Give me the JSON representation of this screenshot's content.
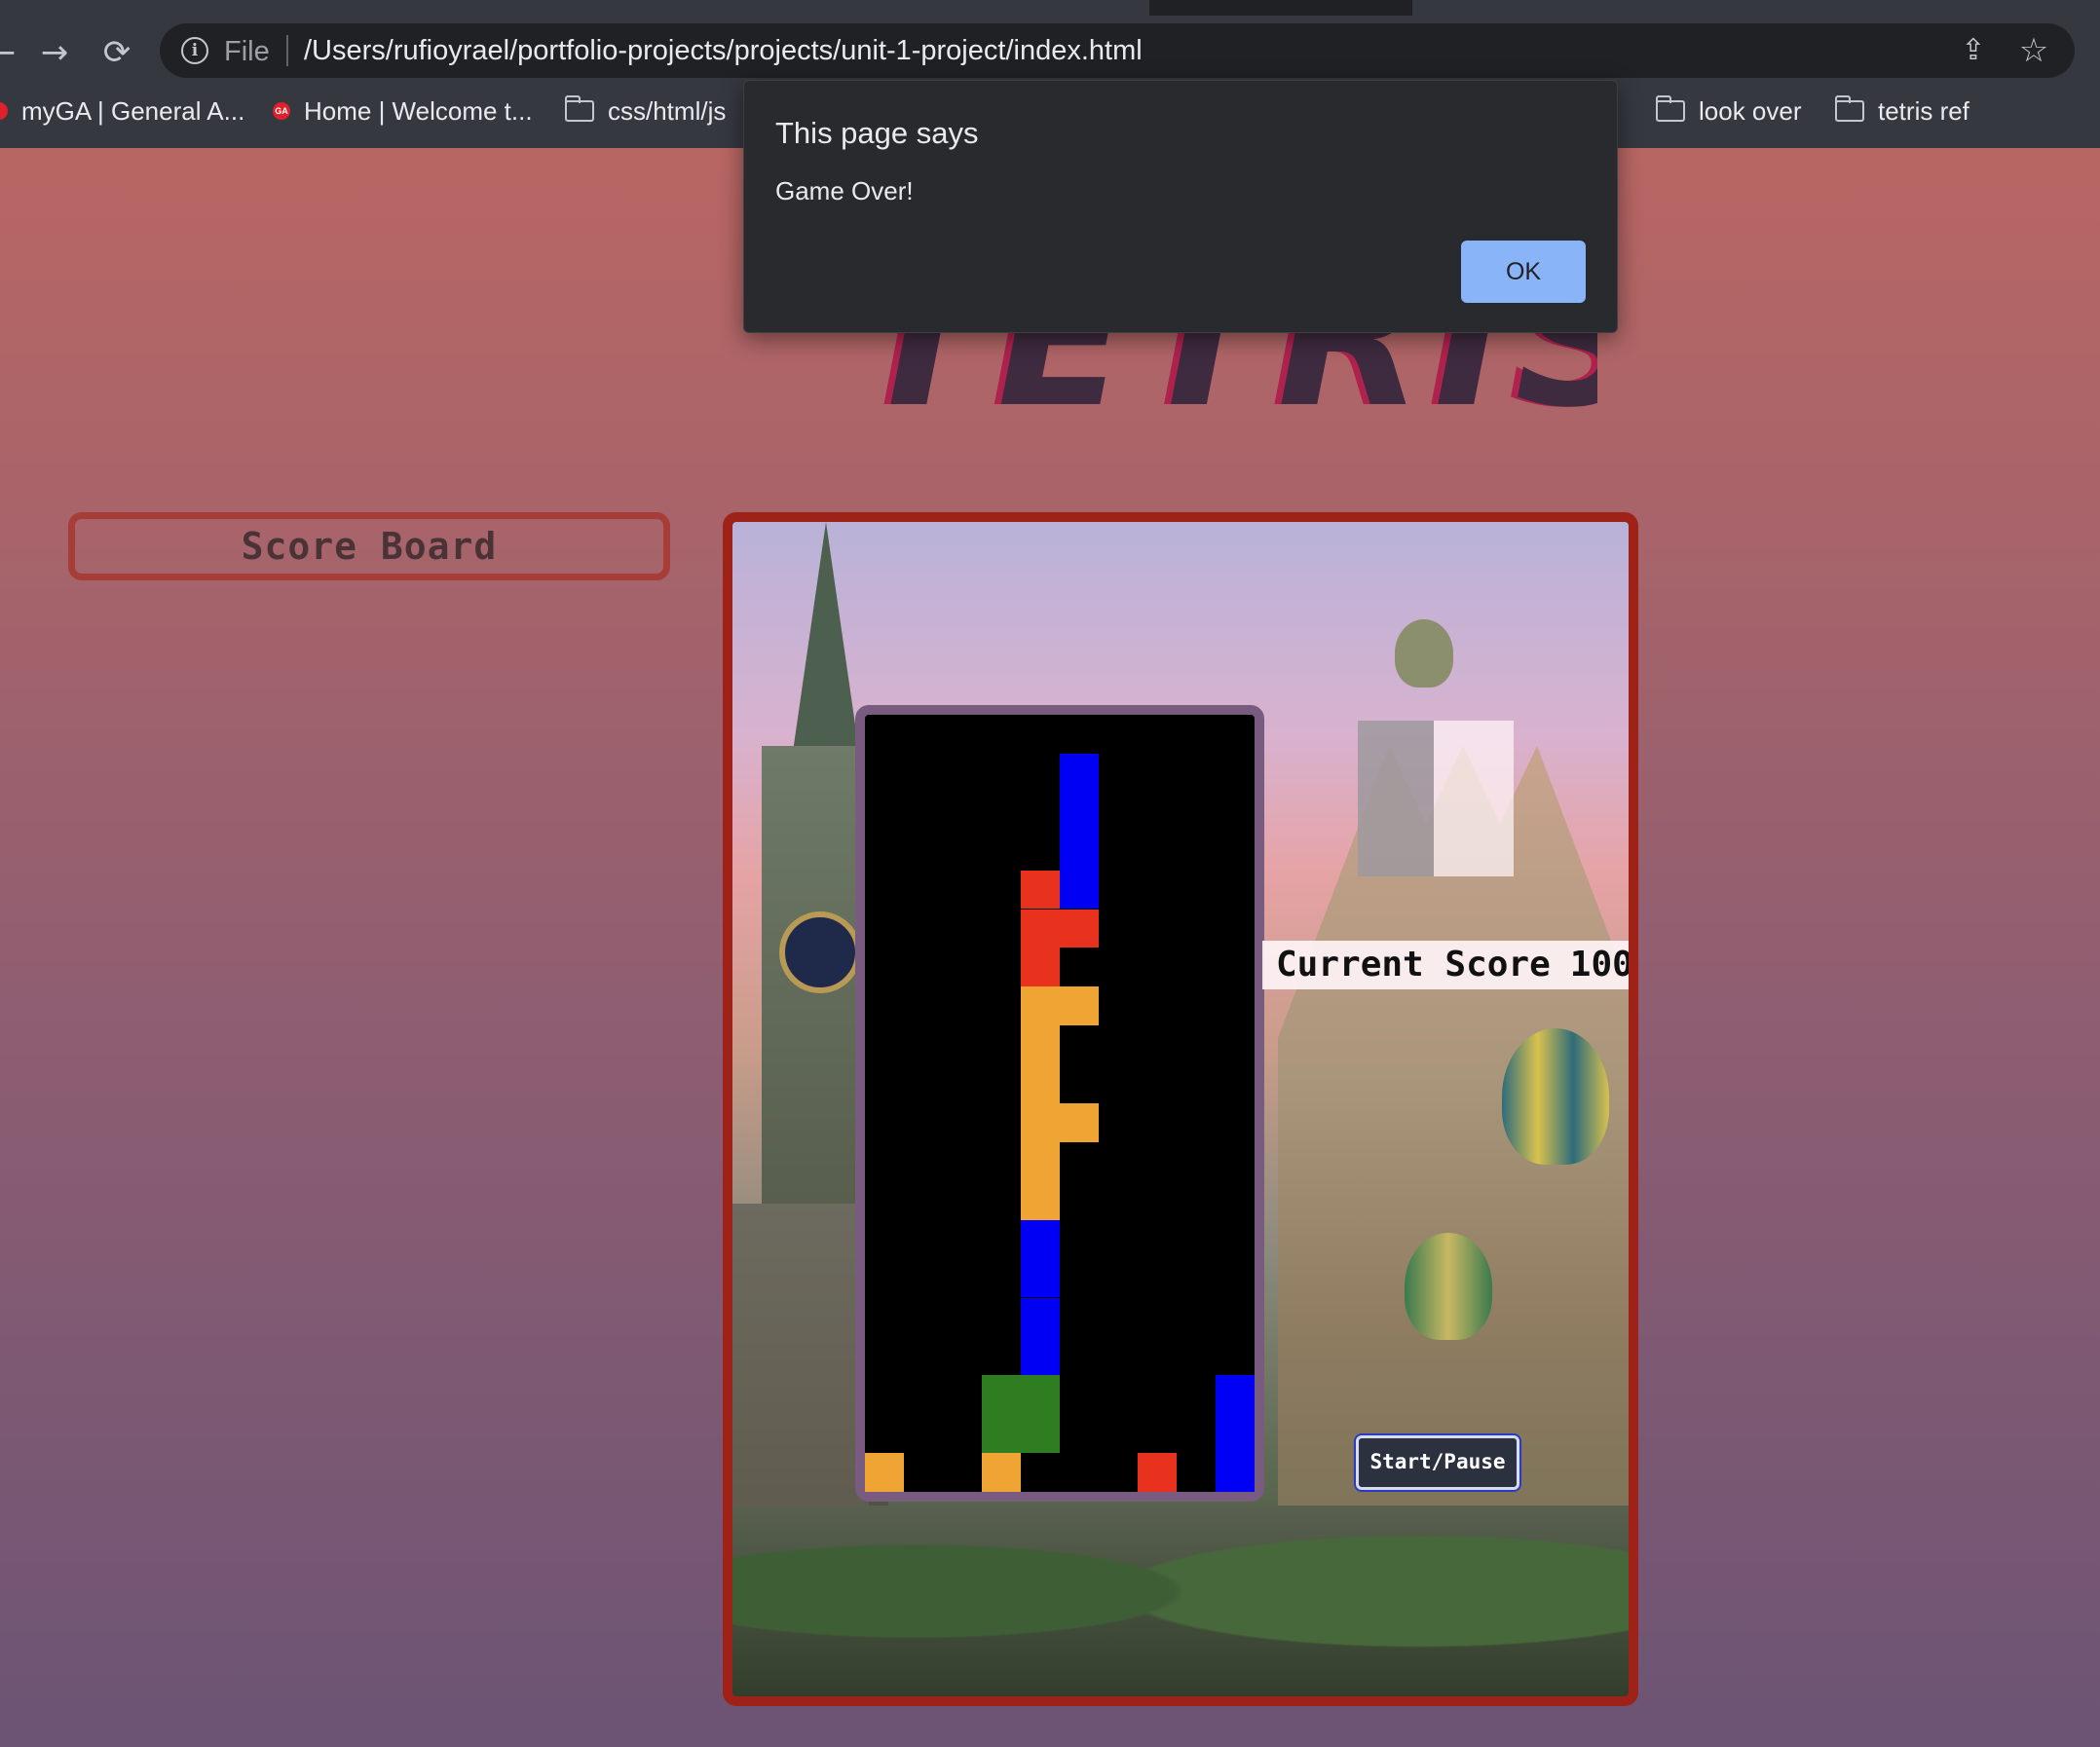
{
  "browser": {
    "nav": {
      "back_glyph": "←",
      "forward_glyph": "→",
      "reload_glyph": "⟳"
    },
    "omnibox": {
      "scheme_label": "File",
      "url": "/Users/rufioyrael/portfolio-projects/projects/unit-1-project/index.html"
    },
    "icons": [
      "info-icon",
      "share-icon",
      "star-icon",
      "reload-icon",
      "folder-icon"
    ],
    "bookmarks": [
      {
        "label": "myGA | General A...",
        "icon": "ga-favicon"
      },
      {
        "label": "Home | Welcome t...",
        "icon": "ga-favicon"
      },
      {
        "label": "css/html/js",
        "icon": "folder-icon"
      },
      {
        "label": "look over",
        "icon": "folder-icon"
      },
      {
        "label": "tetris ref",
        "icon": "folder-icon"
      }
    ]
  },
  "page": {
    "title": "TETRIS",
    "scoreboard_label": "Score Board",
    "current_score_label": "Current Score",
    "current_score_value": "100",
    "start_pause_label": "Start/Pause"
  },
  "board": {
    "columns": 10,
    "rows": 20,
    "colors": {
      "blue": "#0000f5",
      "red": "#e8321e",
      "orange": "#f0a433",
      "green": "#2e7d20",
      "empty": "#000000"
    },
    "cells": [
      {
        "col": 5,
        "row": 1,
        "color": "blue"
      },
      {
        "col": 5,
        "row": 2,
        "color": "blue"
      },
      {
        "col": 5,
        "row": 3,
        "color": "blue"
      },
      {
        "col": 5,
        "row": 4,
        "color": "blue"
      },
      {
        "col": 4,
        "row": 4,
        "color": "red"
      },
      {
        "col": 4,
        "row": 5,
        "color": "red"
      },
      {
        "col": 5,
        "row": 5,
        "color": "red"
      },
      {
        "col": 4,
        "row": 6,
        "color": "red"
      },
      {
        "col": 4,
        "row": 7,
        "color": "orange"
      },
      {
        "col": 5,
        "row": 7,
        "color": "orange"
      },
      {
        "col": 4,
        "row": 8,
        "color": "orange"
      },
      {
        "col": 4,
        "row": 9,
        "color": "orange"
      },
      {
        "col": 4,
        "row": 10,
        "color": "orange"
      },
      {
        "col": 5,
        "row": 10,
        "color": "orange"
      },
      {
        "col": 4,
        "row": 11,
        "color": "orange"
      },
      {
        "col": 4,
        "row": 12,
        "color": "orange"
      },
      {
        "col": 4,
        "row": 13,
        "color": "blue"
      },
      {
        "col": 4,
        "row": 14,
        "color": "blue"
      },
      {
        "col": 4,
        "row": 15,
        "color": "blue"
      },
      {
        "col": 4,
        "row": 16,
        "color": "blue"
      },
      {
        "col": 3,
        "row": 17,
        "color": "green"
      },
      {
        "col": 4,
        "row": 17,
        "color": "green"
      },
      {
        "col": 3,
        "row": 18,
        "color": "green"
      },
      {
        "col": 4,
        "row": 18,
        "color": "green"
      },
      {
        "col": 9,
        "row": 17,
        "color": "blue"
      },
      {
        "col": 9,
        "row": 18,
        "color": "blue"
      },
      {
        "col": 9,
        "row": 19,
        "color": "blue"
      },
      {
        "col": 0,
        "row": 19,
        "color": "orange"
      },
      {
        "col": 3,
        "row": 19,
        "color": "orange"
      },
      {
        "col": 7,
        "row": 19,
        "color": "red"
      }
    ]
  },
  "dialog": {
    "title": "This page says",
    "message": "Game Over!",
    "ok_label": "OK"
  },
  "colors": {
    "chrome_bg": "#35393f",
    "dialog_bg": "#292a2d",
    "ok_button": "#8ab4f8",
    "frame_border": "#9e2218"
  }
}
